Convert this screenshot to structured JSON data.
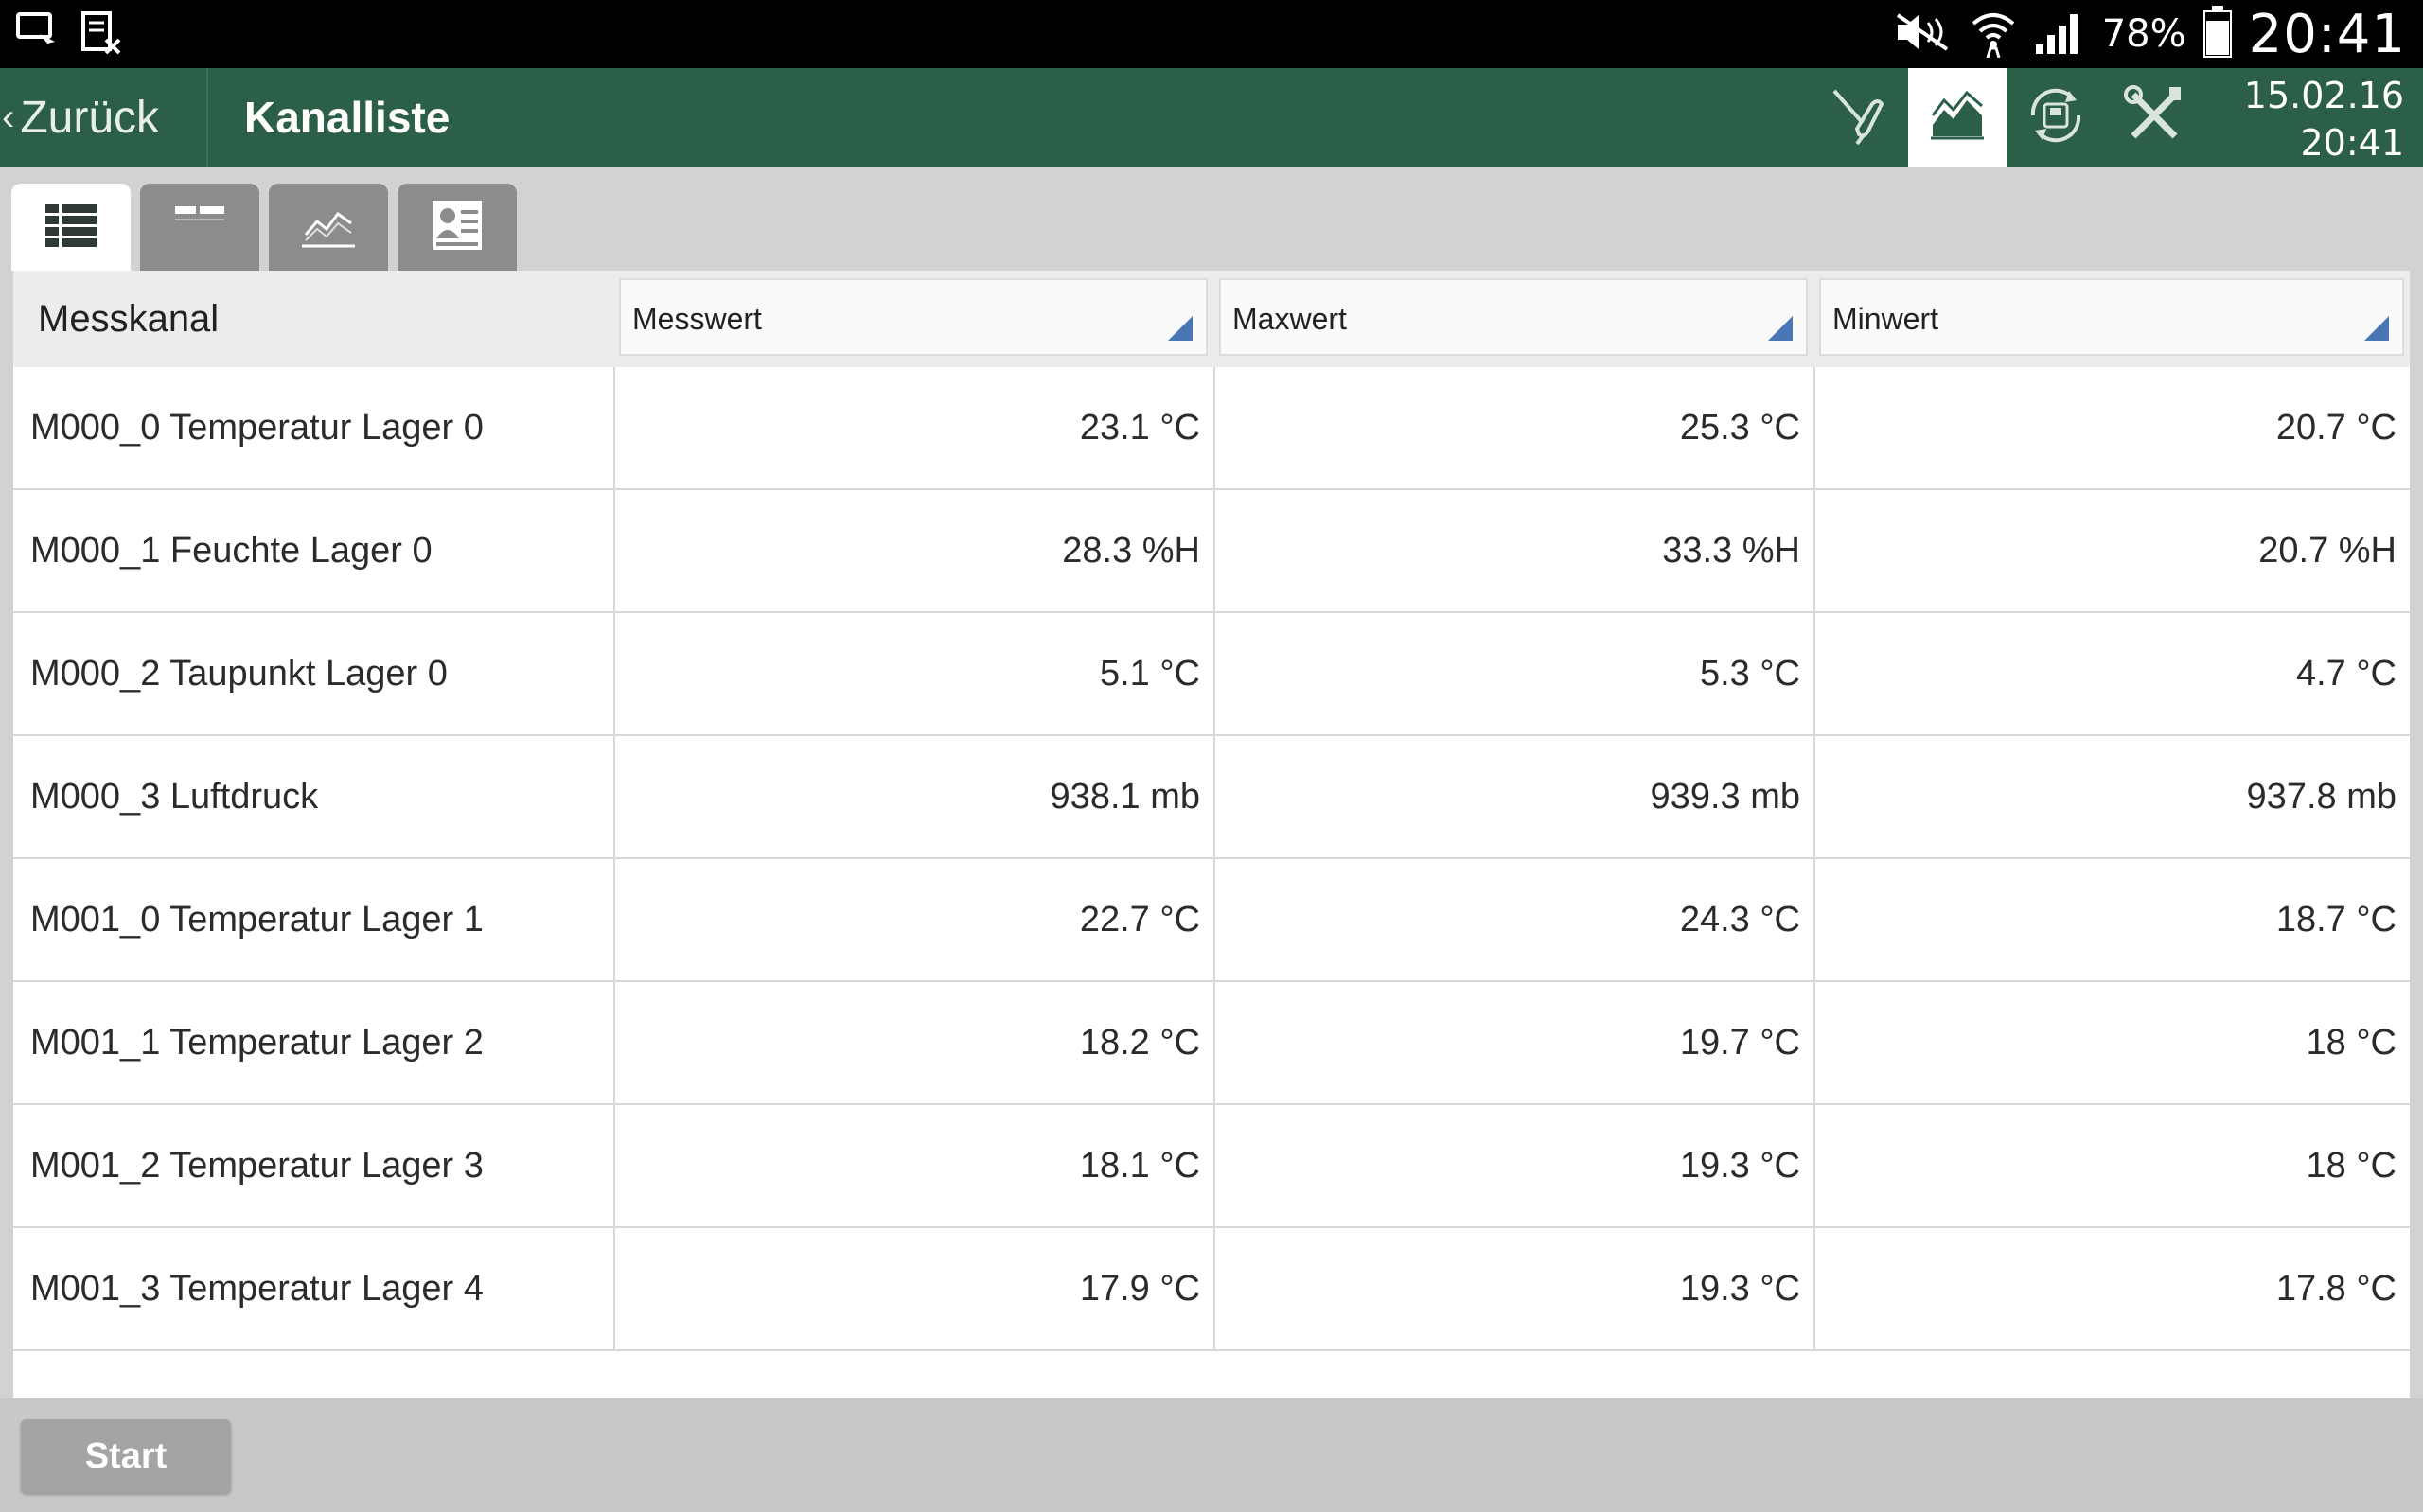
{
  "status_bar": {
    "battery_percent": "78%",
    "time": "20:41"
  },
  "app_bar": {
    "back_label": "Zurück",
    "title": "Kanalliste",
    "date": "15.02.16",
    "time": "20:41"
  },
  "icons": {
    "cast": "cast-icon",
    "table_close": "table-close-icon",
    "mute": "mute-icon",
    "wifi": "wifi-icon",
    "signal": "signal-icon",
    "battery": "battery-icon",
    "probe": "probe-icon",
    "chart": "line-chart-icon",
    "record": "record-sync-icon",
    "tools": "tools-icon",
    "tab_list": "list-view-icon",
    "tab_values": "value-view-icon",
    "tab_chart": "chart-view-icon",
    "tab_report": "report-view-icon"
  },
  "colors": {
    "app_bar": "#2c5f48",
    "status_bar": "#000000",
    "sort_indicator": "#4a76b5"
  },
  "table": {
    "first_header": "Messkanal",
    "headers": [
      "Messwert",
      "Maxwert",
      "Minwert"
    ],
    "rows": [
      {
        "channel": "M000_0 Temperatur Lager 0",
        "value": "23.1 °C",
        "max": "25.3 °C",
        "min": "20.7 °C"
      },
      {
        "channel": "M000_1 Feuchte Lager 0",
        "value": "28.3 %H",
        "max": "33.3 %H",
        "min": "20.7 %H"
      },
      {
        "channel": "M000_2 Taupunkt Lager 0",
        "value": "5.1 °C",
        "max": "5.3 °C",
        "min": "4.7 °C"
      },
      {
        "channel": "M000_3 Luftdruck",
        "value": "938.1 mb",
        "max": "939.3 mb",
        "min": "937.8 mb"
      },
      {
        "channel": "M001_0 Temperatur Lager 1",
        "value": "22.7 °C",
        "max": "24.3 °C",
        "min": "18.7 °C"
      },
      {
        "channel": "M001_1 Temperatur Lager 2",
        "value": "18.2 °C",
        "max": "19.7 °C",
        "min": "18 °C"
      },
      {
        "channel": "M001_2 Temperatur Lager 3",
        "value": "18.1 °C",
        "max": "19.3 °C",
        "min": "18 °C"
      },
      {
        "channel": "M001_3 Temperatur Lager 4",
        "value": "17.9 °C",
        "max": "19.3 °C",
        "min": "17.8 °C"
      }
    ]
  },
  "footer": {
    "start_label": "Start"
  }
}
